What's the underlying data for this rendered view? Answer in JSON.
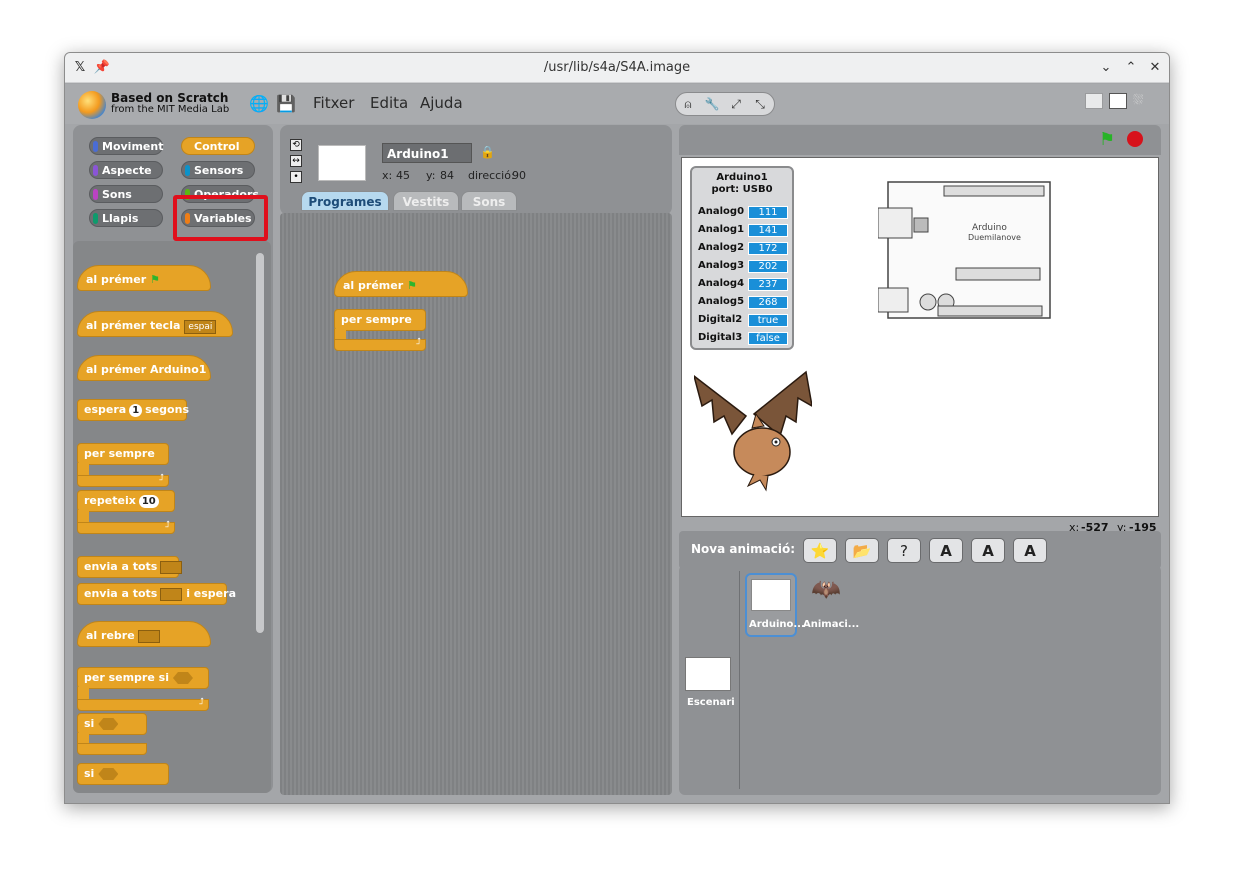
{
  "window": {
    "title": "/usr/lib/s4a/S4A.image"
  },
  "logo": {
    "line1": "Based on Scratch",
    "line2": "from the MIT Media Lab"
  },
  "menu": {
    "file": "Fitxer",
    "edit": "Edita",
    "help": "Ajuda"
  },
  "categories": [
    {
      "label": "Moviment",
      "color": "#4a6cd4"
    },
    {
      "label": "Control",
      "color": "#e6a326"
    },
    {
      "label": "Aspecte",
      "color": "#8a55d7"
    },
    {
      "label": "Sensors",
      "color": "#0c92c9"
    },
    {
      "label": "Sons",
      "color": "#bb42c3"
    },
    {
      "label": "Operadors",
      "color": "#5cb712"
    },
    {
      "label": "Llapis",
      "color": "#0e9a6c"
    },
    {
      "label": "Variables",
      "color": "#ee7d16"
    }
  ],
  "palette": {
    "when_flag": "al prémer",
    "when_key": "al prémer tecla",
    "key_option": "espai",
    "when_clicked": "al prémer  Arduino1",
    "wait_pre": "espera",
    "wait_num": "1",
    "wait_post": "segons",
    "forever": "per sempre",
    "repeat": "repeteix",
    "repeat_num": "10",
    "broadcast": "envia a tots",
    "broadcast_wait": "envia a tots",
    "broadcast_wait_post": "i espera",
    "receive": "al rebre",
    "forever_if": "per sempre si",
    "if1": "si",
    "if2": "si"
  },
  "sprite": {
    "name": "Arduino1",
    "x_label": "x:",
    "x": "45",
    "y_label": "y:",
    "y": "84",
    "dir_label": "direcció:",
    "dir": "90"
  },
  "tabs": {
    "scripts": "Programes",
    "costumes": "Vestits",
    "sounds": "Sons"
  },
  "script": {
    "hat": "al prémer",
    "forever": "per sempre"
  },
  "watcher": {
    "title": "Arduino1",
    "port": "port: USB0",
    "rows": [
      {
        "label": "Analog0",
        "value": "111"
      },
      {
        "label": "Analog1",
        "value": "141"
      },
      {
        "label": "Analog2",
        "value": "172"
      },
      {
        "label": "Analog3",
        "value": "202"
      },
      {
        "label": "Analog4",
        "value": "237"
      },
      {
        "label": "Analog5",
        "value": "268"
      },
      {
        "label": "Digital2",
        "value": "true"
      },
      {
        "label": "Digital3",
        "value": "false"
      }
    ]
  },
  "board": {
    "line1": "Arduino",
    "line2": "Duemilanove"
  },
  "mouse": {
    "x_label": "x:",
    "x": "-527",
    "y_label": "y:",
    "y": "-195"
  },
  "new_sprite": {
    "label": "Nova animació:"
  },
  "sprites": [
    {
      "name": "Arduino..."
    },
    {
      "name": "Animaci..."
    }
  ],
  "stage_label": "Escenari"
}
